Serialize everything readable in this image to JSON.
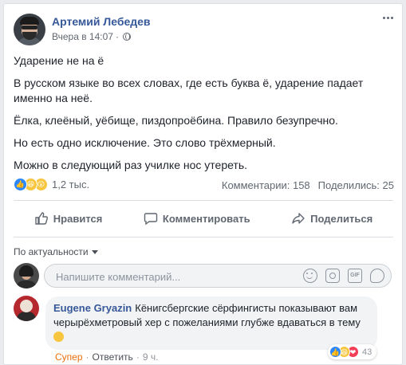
{
  "post": {
    "author": "Артемий Лебедев",
    "time": "Вчера в 14:07",
    "separator": "·",
    "paragraphs": [
      "Ударение не на ё",
      "В русском языке во всех словах, где есть буква ё, ударение падает именно на неё.",
      "Ёлка, клеёный, уёбище, пиздопроёбина. Правило безупречно.",
      "Но есть одно исключение. Это слово трёхмерный.",
      "Можно в следующий раз училке нос утереть."
    ]
  },
  "reactions": {
    "icons": [
      "like-icon",
      "haha-icon",
      "wow-icon"
    ],
    "count": "1,2 тыс.",
    "comments": "Комментарии: 158",
    "shares": "Поделились: 25"
  },
  "actions": {
    "like": "Нравится",
    "comment": "Комментировать",
    "share": "Поделиться"
  },
  "sort": {
    "label": "По актуальности"
  },
  "composer": {
    "placeholder": "Напишите комментарий...",
    "icons": [
      "emoji-icon",
      "camera-icon",
      "gif-icon",
      "sticker-icon"
    ],
    "gif_label": "GIF"
  },
  "comment": {
    "author": "Eugene Gryazin",
    "text": "Кёнигсбергские сёрфингисты показывают вам черырёхметровый хер с пожеланиями глубже вдаваться в тему",
    "reaction_label": "Супер",
    "reply": "Ответить",
    "time": "9 ч.",
    "dot": "·",
    "reactions": [
      "like-icon",
      "haha-icon",
      "love-icon"
    ],
    "reaction_count": "43"
  },
  "colors": {
    "link": "#365899",
    "muted": "#606770",
    "super": "#e9710f",
    "background": "#e9ebee"
  }
}
